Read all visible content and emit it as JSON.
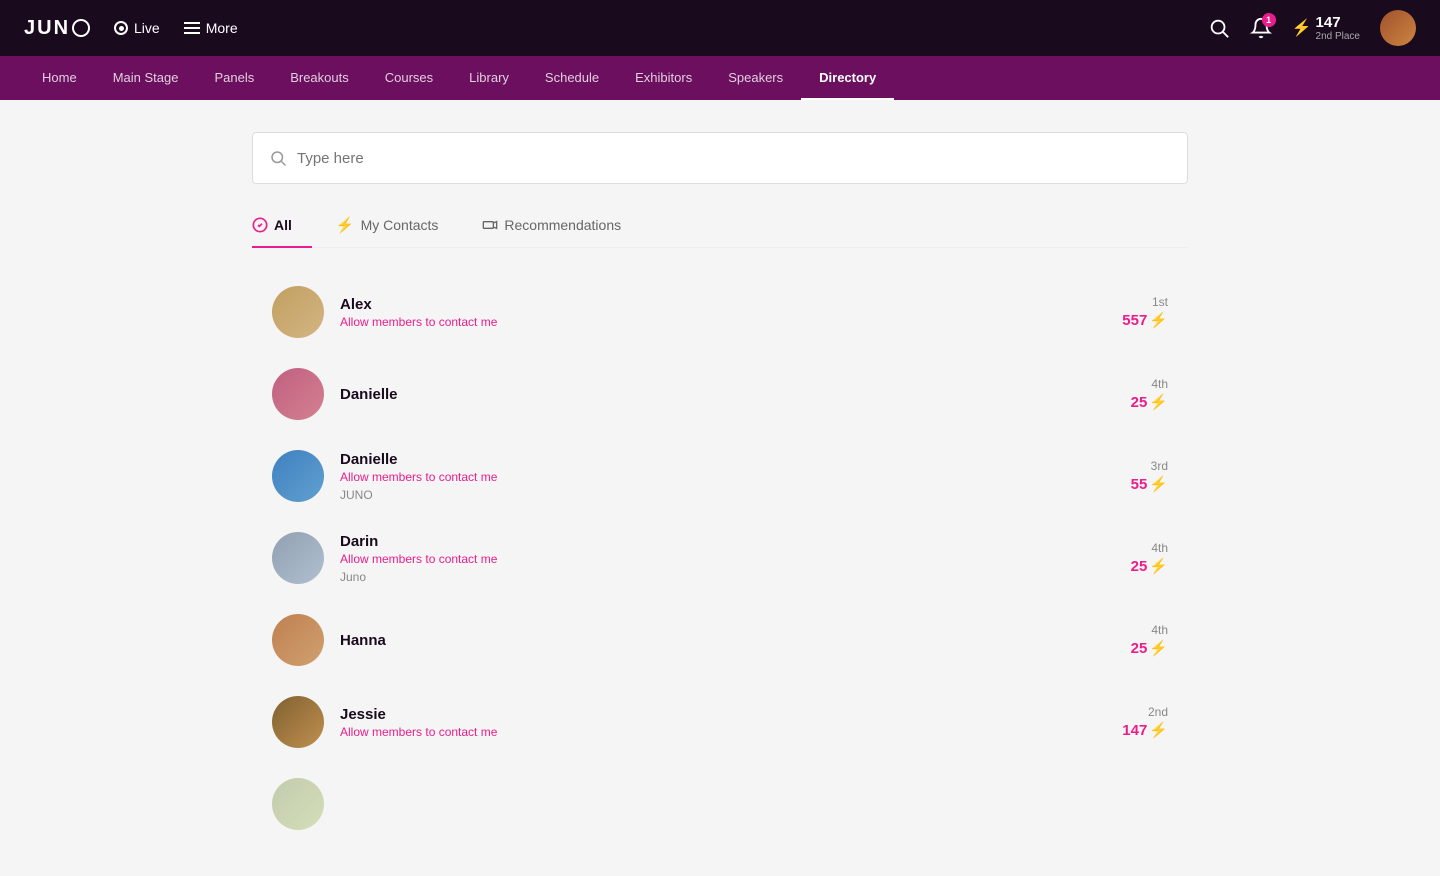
{
  "topNav": {
    "logo": "JUNO",
    "live_label": "Live",
    "more_label": "More",
    "notifications_count": "1",
    "points": {
      "value": "147",
      "rank": "2nd Place"
    }
  },
  "secNav": {
    "items": [
      {
        "id": "home",
        "label": "Home",
        "active": false
      },
      {
        "id": "main-stage",
        "label": "Main Stage",
        "active": false
      },
      {
        "id": "panels",
        "label": "Panels",
        "active": false
      },
      {
        "id": "breakouts",
        "label": "Breakouts",
        "active": false
      },
      {
        "id": "courses",
        "label": "Courses",
        "active": false
      },
      {
        "id": "library",
        "label": "Library",
        "active": false
      },
      {
        "id": "schedule",
        "label": "Schedule",
        "active": false
      },
      {
        "id": "exhibitors",
        "label": "Exhibitors",
        "active": false
      },
      {
        "id": "speakers",
        "label": "Speakers",
        "active": false
      },
      {
        "id": "directory",
        "label": "Directory",
        "active": true
      }
    ]
  },
  "search": {
    "placeholder": "Type here"
  },
  "tabs": [
    {
      "id": "all",
      "label": "All",
      "icon": "check-circle",
      "active": true
    },
    {
      "id": "my-contacts",
      "label": "My Contacts",
      "icon": "bolt",
      "active": false
    },
    {
      "id": "recommendations",
      "label": "Recommendations",
      "icon": "video",
      "active": false
    }
  ],
  "members": [
    {
      "id": "alex",
      "name": "Alex",
      "contact_label": "Allow members to contact me",
      "org": "",
      "rank": "1st",
      "points": "557",
      "avatar_class": "av-alex"
    },
    {
      "id": "danielle1",
      "name": "Danielle",
      "contact_label": "",
      "org": "",
      "rank": "4th",
      "points": "25",
      "avatar_class": "av-danielle1"
    },
    {
      "id": "danielle2",
      "name": "Danielle",
      "contact_label": "Allow members to contact me",
      "org": "JUNO",
      "rank": "3rd",
      "points": "55",
      "avatar_class": "av-danielle2"
    },
    {
      "id": "darin",
      "name": "Darin",
      "contact_label": "Allow members to contact me",
      "org": "Juno",
      "rank": "4th",
      "points": "25",
      "avatar_class": "av-darin"
    },
    {
      "id": "hanna",
      "name": "Hanna",
      "contact_label": "",
      "org": "",
      "rank": "4th",
      "points": "25",
      "avatar_class": "av-hanna"
    },
    {
      "id": "jessie",
      "name": "Jessie",
      "contact_label": "Allow members to contact me",
      "org": "",
      "rank": "2nd",
      "points": "147",
      "avatar_class": "av-jessie"
    },
    {
      "id": "last",
      "name": "",
      "contact_label": "",
      "org": "",
      "rank": "",
      "points": "",
      "avatar_class": "av-last"
    }
  ]
}
